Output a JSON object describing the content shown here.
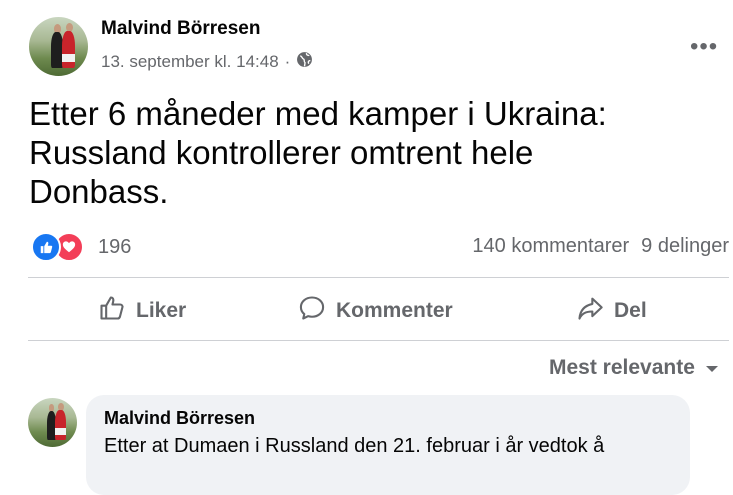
{
  "post": {
    "author": "Malvind Börresen",
    "timestamp": "13. september kl. 14:48",
    "dot": "·",
    "privacy_icon": "globe-icon",
    "more_label": "•••",
    "text_line1": "Etter 6 måneder med kamper i Ukraina:",
    "text_line2": "Russland kontrollerer omtrent hele",
    "text_line3": "Donbass."
  },
  "reactions": {
    "icons": [
      "like-icon",
      "love-icon"
    ],
    "count": "196",
    "comments": "140 kommentarer",
    "shares": "9 delinger"
  },
  "actions": {
    "like": "Liker",
    "comment": "Kommenter",
    "share": "Del"
  },
  "sort": {
    "label": "Mest relevante"
  },
  "comment": {
    "author": "Malvind Börresen",
    "text": "Etter at Dumaen i Russland den 21. februar i år vedtok å"
  },
  "colors": {
    "like_blue": "#1877f2",
    "love_red": "#f33e58",
    "secondary_text": "#65676b",
    "bubble_bg": "#f0f2f5"
  }
}
